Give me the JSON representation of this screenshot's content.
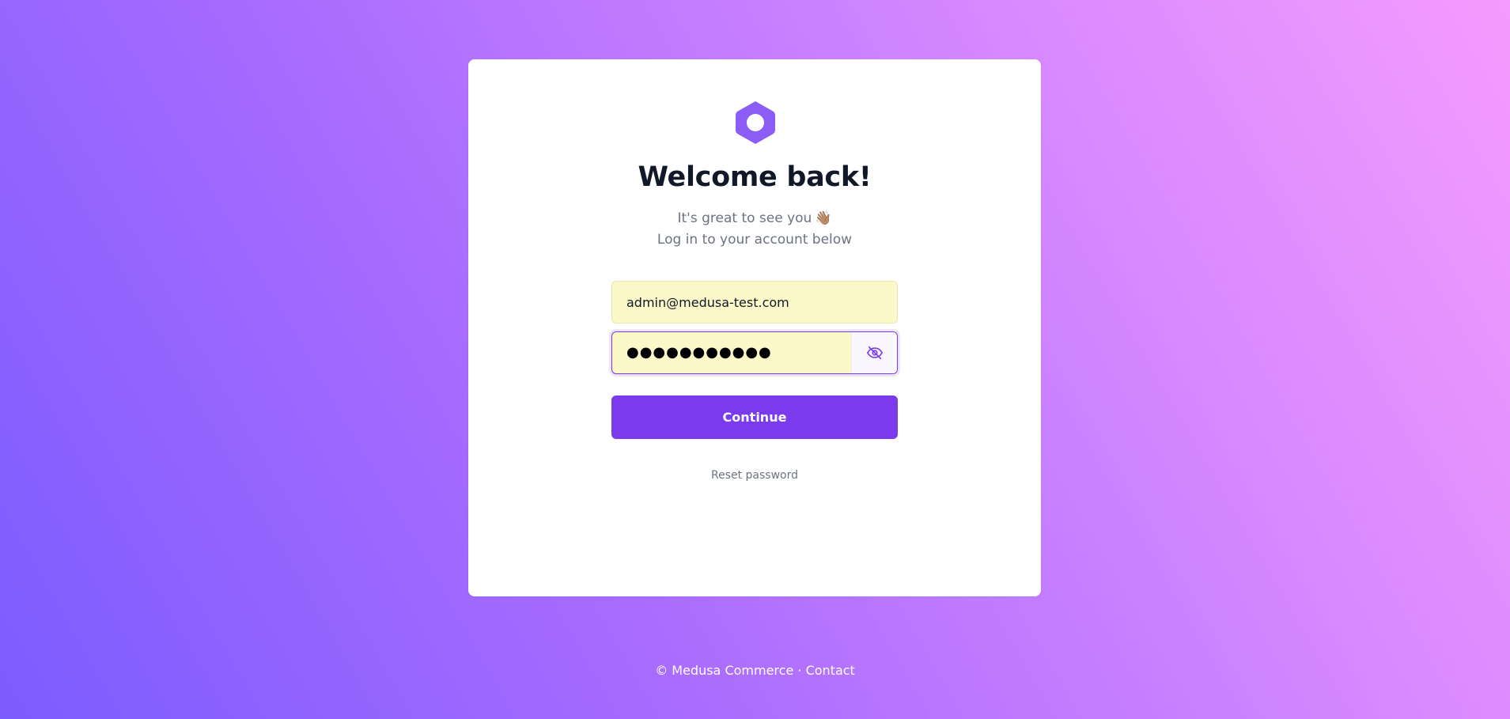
{
  "login": {
    "title": "Welcome back!",
    "subtitle_line1": "It's great to see you",
    "wave_emoji": "👋🏽",
    "subtitle_line2": "Log in to your account below",
    "email_value": "admin@medusa-test.com",
    "password_masked": "●●●●●●●●●●●",
    "continue_label": "Continue",
    "reset_label": "Reset password"
  },
  "footer": {
    "copyright": "© Medusa Commerce",
    "separator": " · ",
    "contact": "Contact"
  },
  "colors": {
    "accent": "#7c3aed",
    "logo": "#8b5cf6",
    "autofill_bg": "#fbf9c8"
  },
  "icons": {
    "logo": "medusa-hexagon-logo",
    "password_toggle": "eye-slash-icon"
  }
}
